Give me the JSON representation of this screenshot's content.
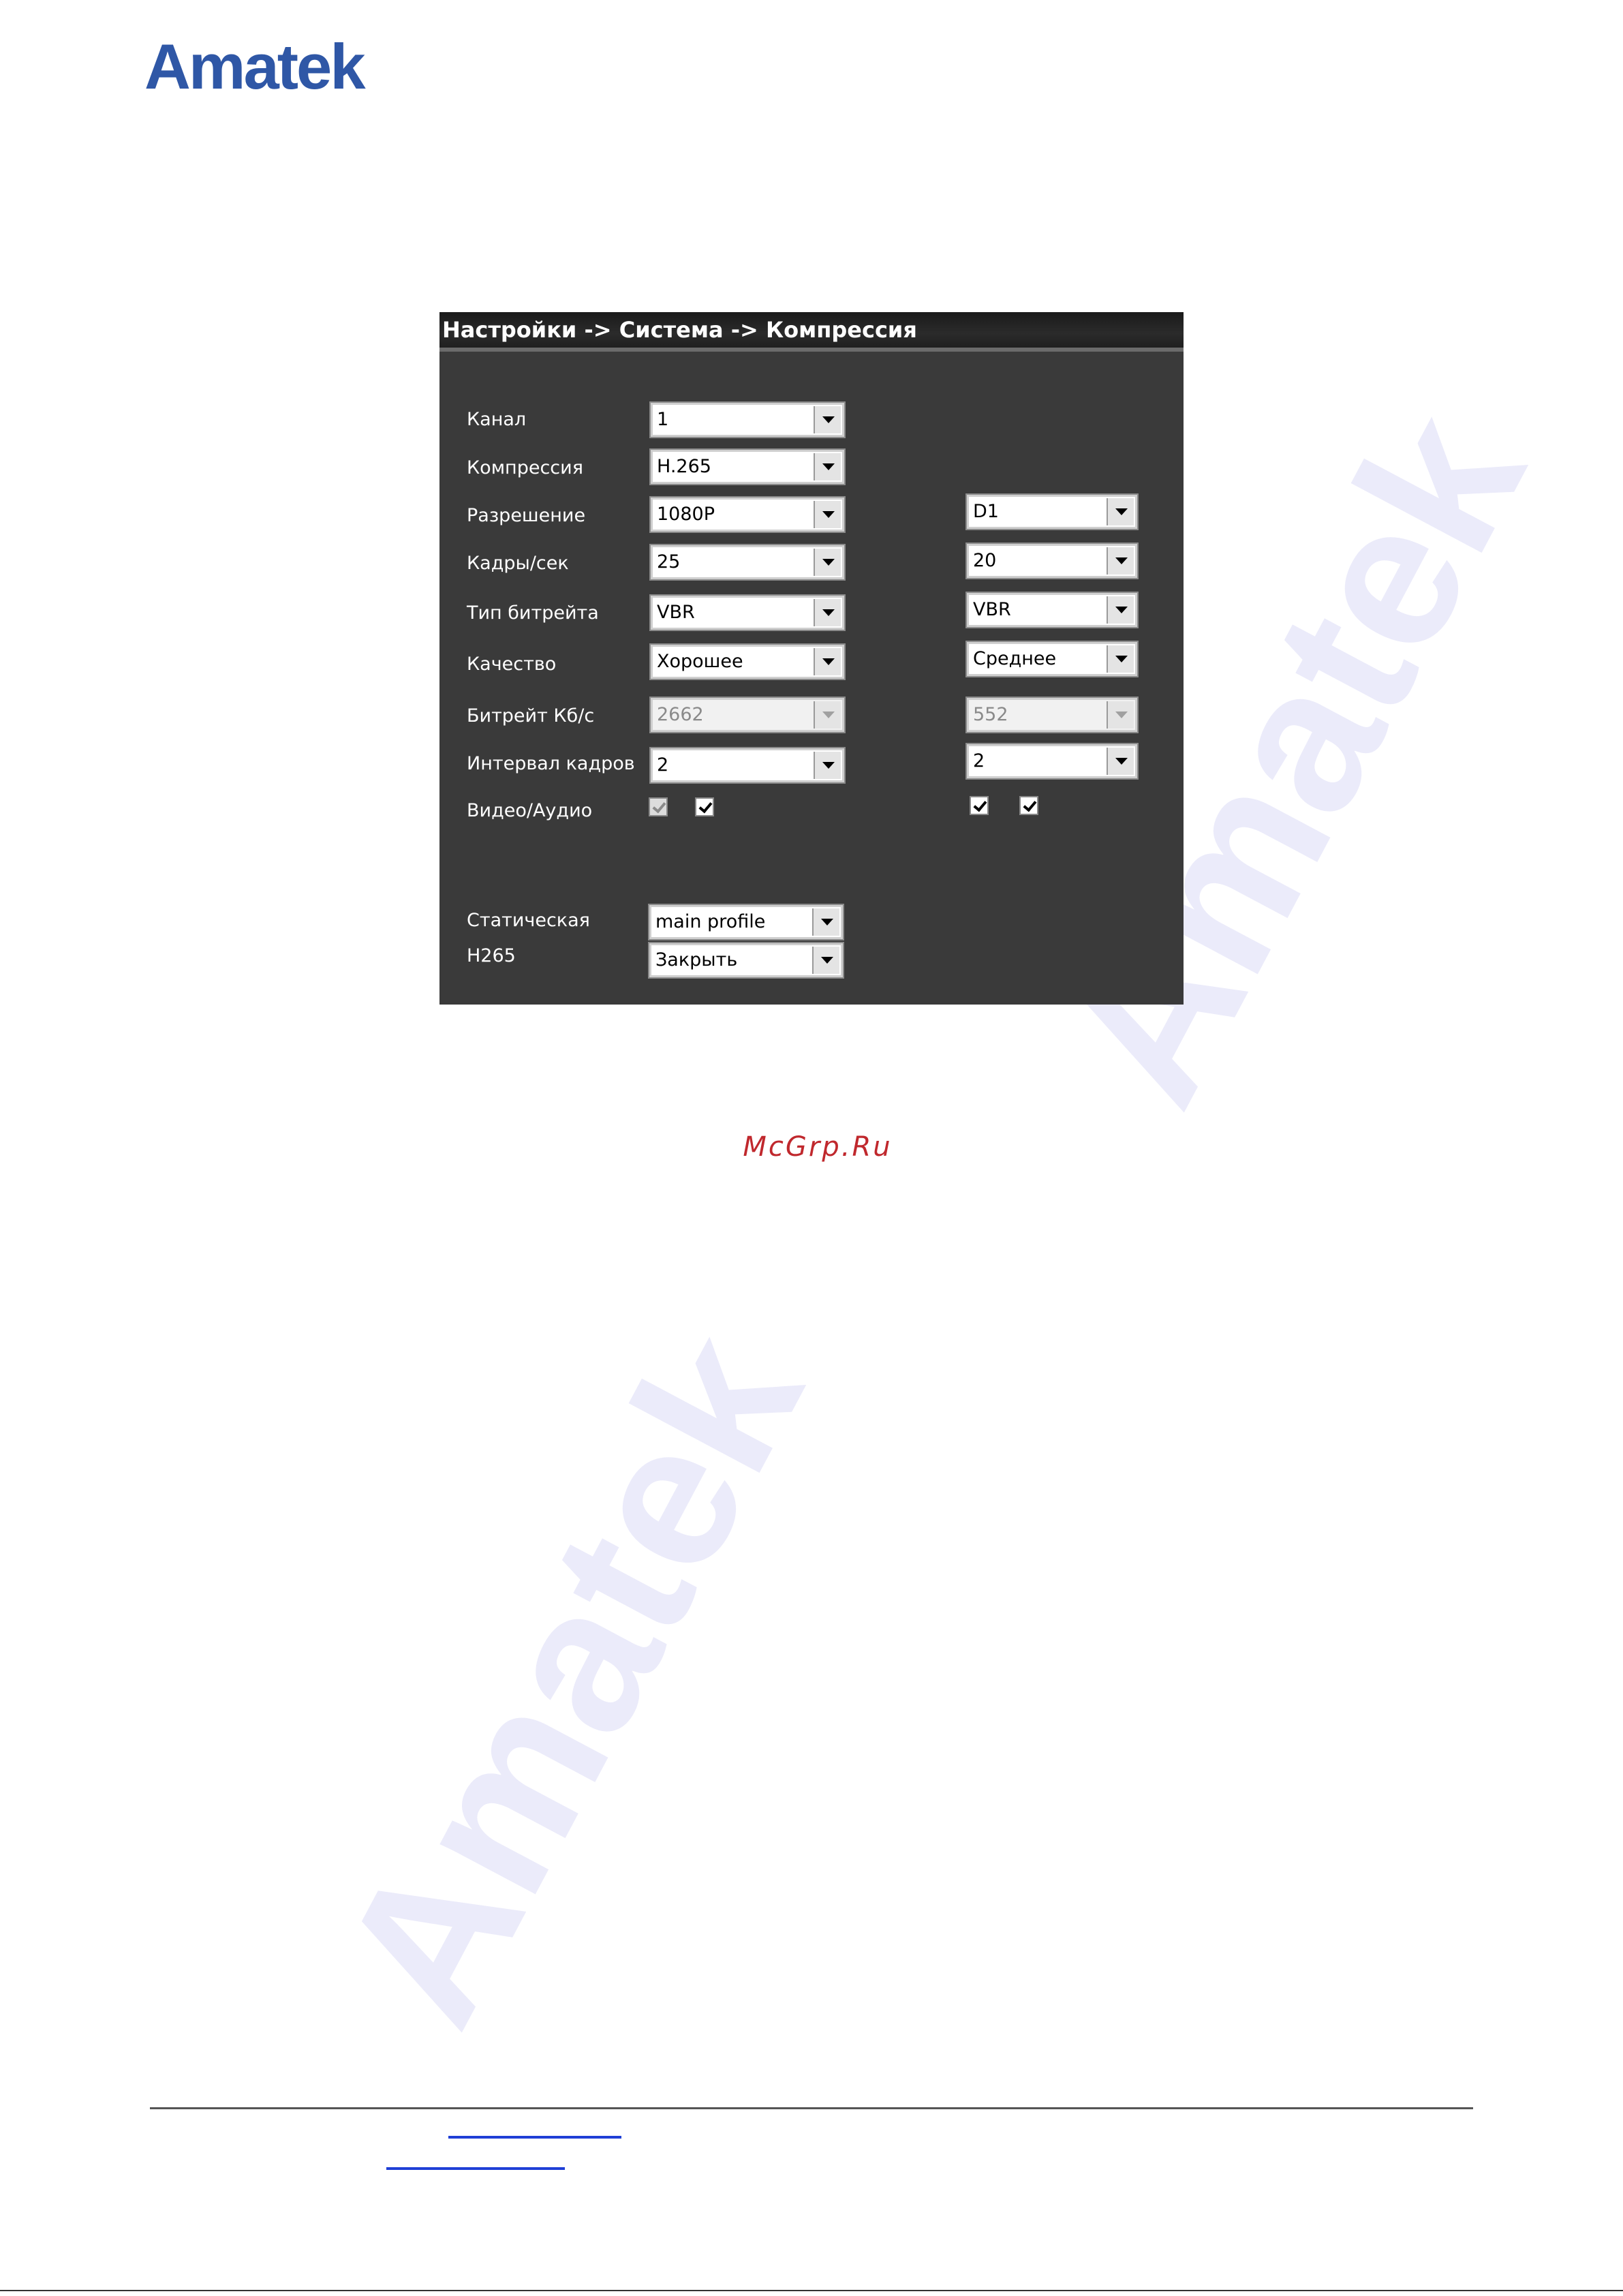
{
  "brand": {
    "logo_text": "Amatek",
    "brand_color": "#2f57a6"
  },
  "watermark": {
    "text": "Amatek"
  },
  "panel": {
    "title": "Настройки -> Система -> Компрессия",
    "rows": {
      "channel": {
        "label": "Канал",
        "main": "1"
      },
      "compression": {
        "label": "Компрессия",
        "main": "H.265"
      },
      "resolution": {
        "label": "Разрешение",
        "main": "1080P",
        "sub": "D1"
      },
      "fps": {
        "label": "Кадры/сек",
        "main": "25",
        "sub": "20"
      },
      "bitrate_type": {
        "label": "Тип битрейта",
        "main": "VBR",
        "sub": "VBR"
      },
      "quality": {
        "label": "Качество",
        "main": "Хорошее",
        "sub": "Среднее"
      },
      "bitrate": {
        "label": "Битрейт Кб/с",
        "main": "2662",
        "sub": "552"
      },
      "gop": {
        "label": "Интервал кадров",
        "main": "2",
        "sub": "2"
      },
      "video_audio": {
        "label": "Видео/Аудио"
      },
      "static": {
        "label": "Статическая",
        "main": "main profile"
      },
      "h265": {
        "label": "H265",
        "main": "Закрыть"
      }
    }
  },
  "site_label": "McGrp.Ru"
}
